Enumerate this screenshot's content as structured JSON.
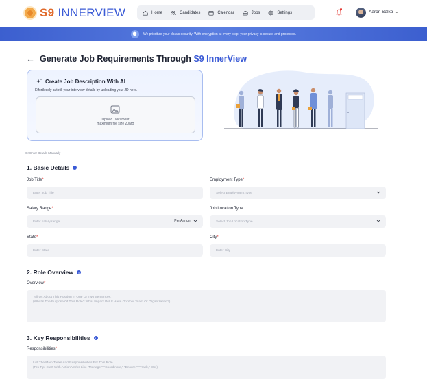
{
  "app": {
    "logo_s9": "S9",
    "logo_name": "INNERVIEW"
  },
  "nav": {
    "items": [
      {
        "label": "Home",
        "icon": "home-icon"
      },
      {
        "label": "Candidates",
        "icon": "users-icon"
      },
      {
        "label": "Calendar",
        "icon": "calendar-icon"
      },
      {
        "label": "Jobs",
        "icon": "briefcase-icon"
      },
      {
        "label": "Settings",
        "icon": "gear-icon"
      }
    ],
    "notification_icon": "bell-icon",
    "user_name": "Aaron Salko"
  },
  "banner": {
    "text": "We prioritize your data's security. With encryption at every step, your privacy is secure and protected."
  },
  "page": {
    "title_prefix": "Generate Job Requirements Through ",
    "title_brand": "S9 InnerView"
  },
  "ai_card": {
    "title": "Create Job Description With AI",
    "subtitle": "Effortlessly autofill your interview details by uploading your JD here.",
    "upload_label": "Upload Document",
    "upload_hint": "maximum file size 20MB"
  },
  "divider": {
    "text": "Or Enter Details Manually"
  },
  "basic_details": {
    "title": "1. Basic Details",
    "job_title_label": "Job Title",
    "job_title_placeholder": "Enter Job Title",
    "employment_type_label": "Employment Type",
    "employment_type_placeholder": "Select Employment Type",
    "salary_label": "Salary Range",
    "salary_placeholder": "Enter salary range",
    "salary_period": "Per Annum",
    "location_type_label": "Job Location Type",
    "location_type_placeholder": "Select Job Location Type",
    "state_label": "State",
    "state_placeholder": "Enter State",
    "city_label": "City",
    "city_placeholder": "Enter City"
  },
  "role_overview": {
    "title": "2. Role Overview",
    "overview_label": "Overview",
    "overview_placeholder_line1": "Tell Us About This Position In One Or Two Sentences.",
    "overview_placeholder_line2": "(What's The Purpose Of This Role? What Impact Will It Have On Your Team Or Organization?)"
  },
  "responsibilities": {
    "title": "3. Key Responsibilities",
    "label": "Responsibilities",
    "placeholder_line1": "List The Main Tasks And Responsibilities For This Role.",
    "placeholder_line2": "(Pro Tip: Start With Action Verbs Like \"Manage,\" \"Coordinate,\" \"Ensure,\" \"Track,\" Etc.)"
  },
  "required_marker": "*",
  "colors": {
    "brand_blue": "#3b5bd6",
    "brand_orange": "#e06a2b",
    "required_red": "#e3342f",
    "banner_blue": "#4a6dd8"
  }
}
